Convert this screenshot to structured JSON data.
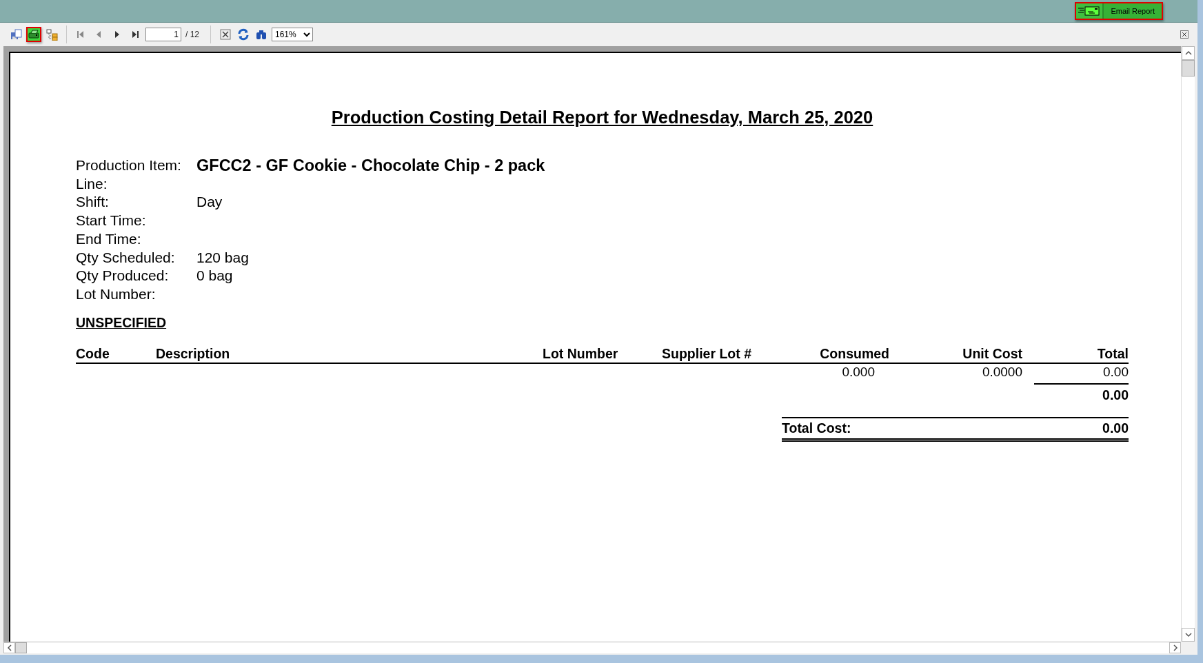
{
  "header": {
    "email_button": "Email Report"
  },
  "toolbar": {
    "buttons": [
      {
        "kind": "export",
        "highlighted": false
      },
      {
        "kind": "print",
        "highlighted": true
      },
      {
        "kind": "tree",
        "highlighted": false
      }
    ],
    "page_input": "1",
    "page_total": "/ 12",
    "zoom": "161%"
  },
  "report": {
    "title": "Production Costing Detail Report for Wednesday, March 25, 2020",
    "fields": [
      {
        "label": "Production Item:",
        "value": "GFCC2 - GF Cookie - Chocolate Chip - 2 pack",
        "emphasis": true
      },
      {
        "label": "Line:"
      },
      {
        "label": "Shift:",
        "value": "Day",
        "emphasis": false
      },
      {
        "label": "Start Time:"
      },
      {
        "label": "End Time:"
      },
      {
        "label": "Qty Scheduled:",
        "value": "120 bag",
        "emphasis": false
      },
      {
        "label": "Qty Produced:",
        "value": "0 bag",
        "emphasis": false
      },
      {
        "label": "Lot Number:"
      }
    ],
    "section": "UNSPECIFIED",
    "columns": [
      "Code",
      "Description",
      "Lot Number",
      "Supplier Lot #",
      "Consumed",
      "Unit Cost",
      "Total"
    ],
    "rows": [
      {
        "consumed": "0.000",
        "unit_cost": "0.0000",
        "total": "0.00"
      }
    ],
    "subtotal": "0.00",
    "total_label": "Total Cost:",
    "total_value": "0.00"
  }
}
